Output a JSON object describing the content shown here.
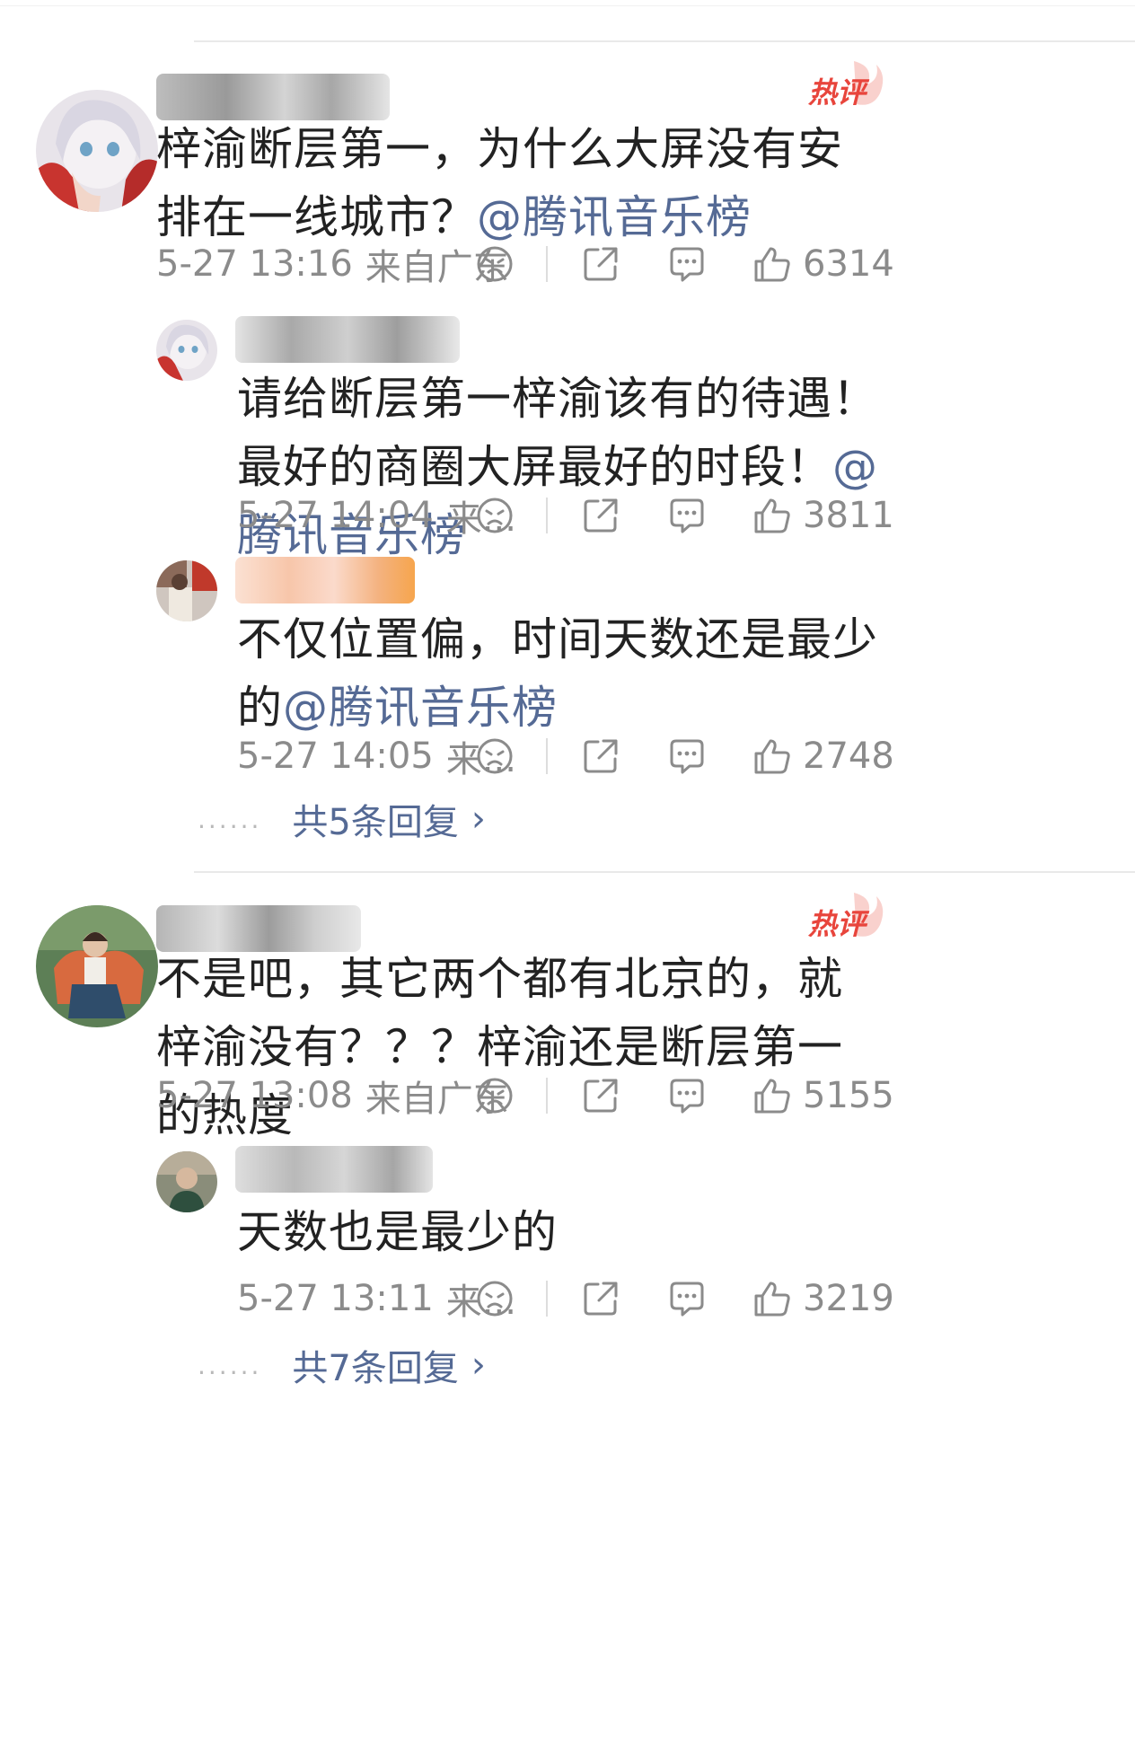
{
  "comments": [
    {
      "badge": "热评",
      "text": "梓渝断层第一，为什么大屏没有安排在一线城市？",
      "mention": "@腾讯音乐榜",
      "time": "5-27 13:16",
      "location": "来自广东",
      "likes": "6314",
      "replies": [
        {
          "text": "请给断层第一梓渝该有的待遇！最好的商圈大屏最好的时段！",
          "mention": "@腾讯音乐榜",
          "time": "5-27 14:04",
          "location": "来...",
          "likes": "3811"
        },
        {
          "text": "不仅位置偏，时间天数还是最少的",
          "mention": "@腾讯音乐榜",
          "time": "5-27 14:05",
          "location": "来...",
          "likes": "2748"
        }
      ],
      "more_dots": "......",
      "more_replies": "共5条回复"
    },
    {
      "badge": "热评",
      "text": "不是吧，其它两个都有北京的，就梓渝没有？？？梓渝还是断层第一的热度",
      "mention": "",
      "time": "5-27 13:08",
      "location": "来自广东",
      "likes": "5155",
      "replies": [
        {
          "text": "天数也是最少的",
          "mention": "",
          "time": "5-27 13:11",
          "location": "来...",
          "likes": "3219"
        }
      ],
      "more_dots": "......",
      "more_replies": "共7条回复"
    }
  ],
  "icons": {
    "dislike": "sad-face-icon",
    "share": "share-icon",
    "comment": "comment-bubble-icon",
    "like": "thumbs-up-icon",
    "more": "chevron-right-icon"
  },
  "colors": {
    "mention": "#556a95",
    "meta": "#8b8b8b",
    "hot_badge": "#e8453c"
  }
}
